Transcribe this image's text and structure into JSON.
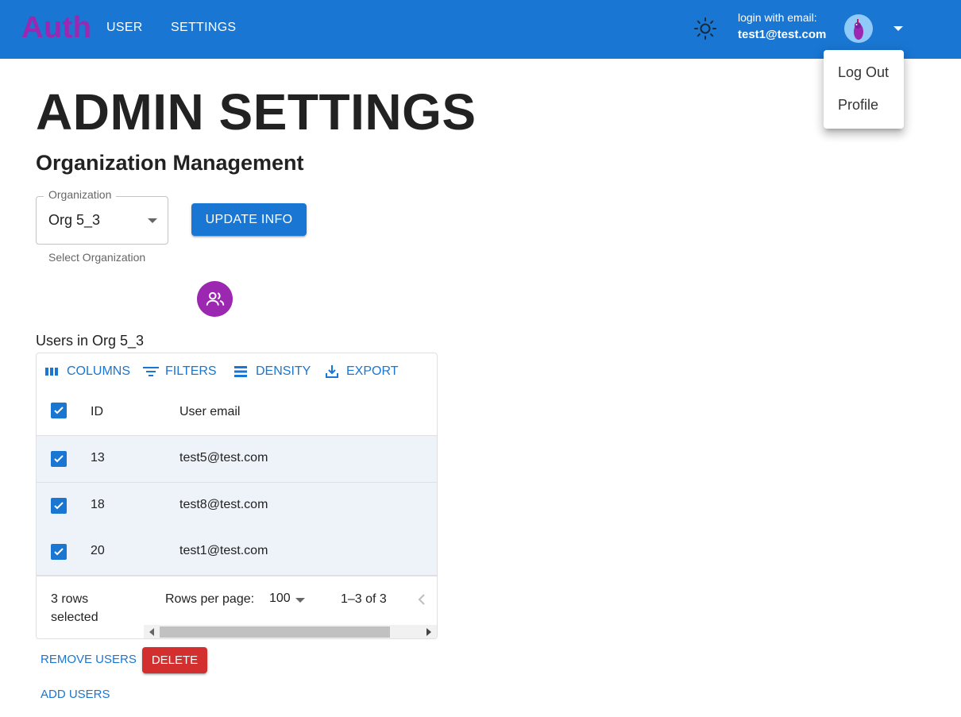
{
  "appbar": {
    "logo": "Auth",
    "nav": [
      {
        "label": "USER"
      },
      {
        "label": "SETTINGS"
      }
    ],
    "login_label": "login with email:",
    "login_email": "test1@test.com",
    "icons": [
      "sun-icon",
      "avatar",
      "chevron-down-icon"
    ]
  },
  "account_menu": {
    "items": [
      {
        "label": "Log Out"
      },
      {
        "label": "Profile"
      }
    ]
  },
  "page": {
    "title": "ADMIN SETTINGS",
    "section_title": "Organization Management"
  },
  "org_select": {
    "label": "Organization",
    "value": "Org 5_3",
    "helper": "Select Organization"
  },
  "update_button": "UPDATE INFO",
  "users_caption": "Users in Org 5_3",
  "grid": {
    "toolbar": [
      {
        "label": "COLUMNS",
        "icon": "columns-icon"
      },
      {
        "label": "FILTERS",
        "icon": "filter-icon"
      },
      {
        "label": "DENSITY",
        "icon": "density-icon"
      },
      {
        "label": "EXPORT",
        "icon": "export-icon"
      }
    ],
    "columns": [
      "ID",
      "User email"
    ],
    "rows": [
      {
        "id": "13",
        "email": "test5@test.com",
        "selected": true
      },
      {
        "id": "18",
        "email": "test8@test.com",
        "selected": true
      },
      {
        "id": "20",
        "email": "test1@test.com",
        "selected": true
      }
    ],
    "footer": {
      "selected": "3 rows selected",
      "rows_per_page_label": "Rows per page:",
      "rows_per_page_value": "100",
      "range": "1–3 of 3"
    }
  },
  "actions": {
    "remove": "REMOVE USERS",
    "delete": "DELETE",
    "add": "ADD USERS"
  },
  "colors": {
    "primary": "#1976d2",
    "secondary": "#9c27b0",
    "error": "#d32f2f"
  }
}
